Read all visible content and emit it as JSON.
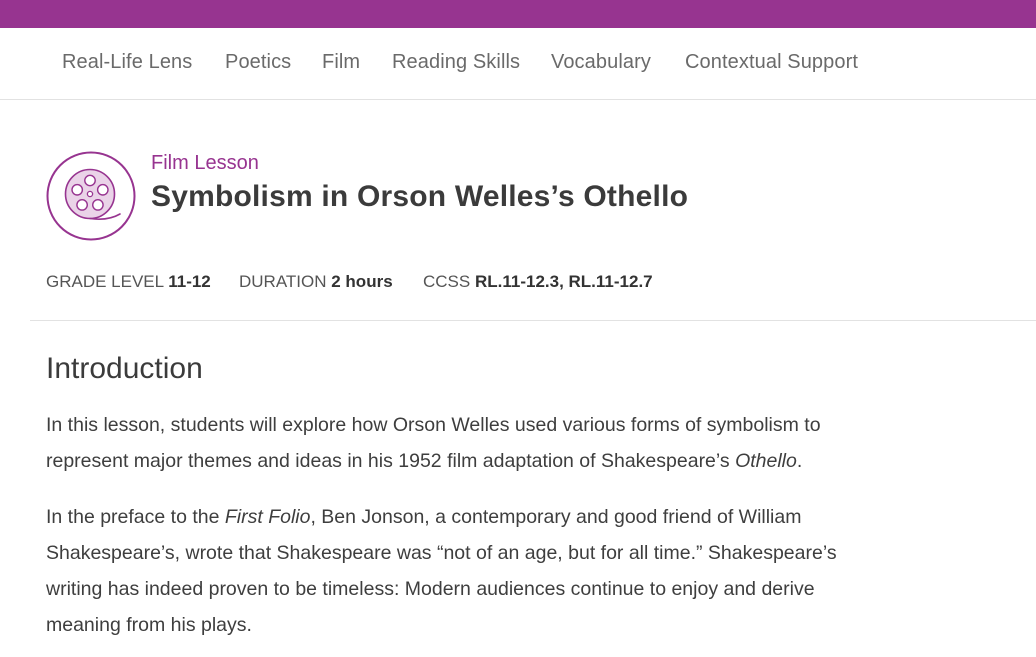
{
  "nav": {
    "items": [
      {
        "label": "Real-Life Lens"
      },
      {
        "label": "Poetics"
      },
      {
        "label": "Film"
      },
      {
        "label": "Reading Skills"
      },
      {
        "label": "Vocabulary"
      },
      {
        "label": "Contextual Support"
      }
    ]
  },
  "lesson": {
    "kicker": "Film Lesson",
    "title": "Symbolism in Orson Welles’s Othello",
    "icon": "film-reel-icon",
    "accent_color": "#973490"
  },
  "meta": {
    "grade_label": "GRADE LEVEL",
    "grade_value": "11-12",
    "duration_label": "DURATION",
    "duration_value": "2 hours",
    "ccss_label": "CCSS",
    "ccss_value": "RL.11-12.3, RL.11-12.7"
  },
  "intro": {
    "heading": "Introduction",
    "p1_a": "In this lesson, students will explore how Orson Welles used various forms of symbolism to represent major themes and ideas in his 1952 film adaptation of Shakespeare’s ",
    "p1_em": "Othello",
    "p1_b": ".",
    "p2_a": "In the preface to the ",
    "p2_em": "First Folio",
    "p2_b": ", Ben Jonson, a contemporary and good friend of William Shakespeare’s, wrote that Shakespeare was “not of an age, but for all time.”  Shakespeare’s writing has indeed proven to be timeless: Modern audiences continue to enjoy and derive meaning from his plays."
  }
}
